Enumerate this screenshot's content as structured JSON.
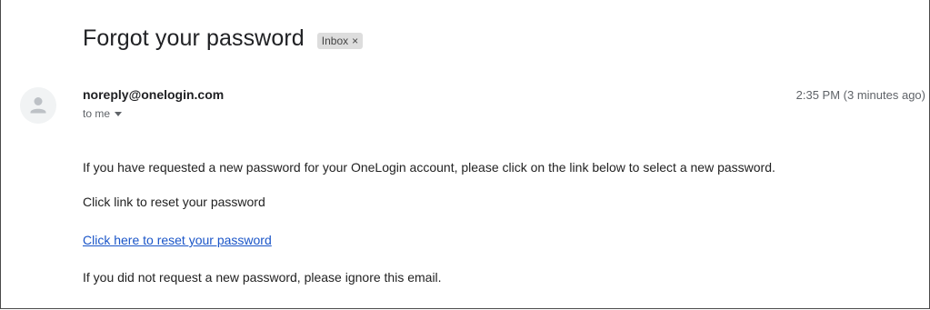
{
  "email": {
    "subject": "Forgot your password",
    "label": "Inbox",
    "label_close": "×",
    "sender": "noreply@onelogin.com",
    "recipient": "to me",
    "timestamp": "2:35 PM (3 minutes ago)",
    "body": {
      "line1": "If you have requested a new password for your OneLogin account, please click on the link below to select a new password.",
      "line2": "Click link to reset your password",
      "link_text": "Click here to reset your password",
      "line4": "If you did not request a new password, please ignore this email."
    }
  },
  "icons": {
    "avatar": "default-person-avatar-icon",
    "recipient_details": "chevron-down-icon"
  },
  "colors": {
    "link": "#1a55c8",
    "label_chip_bg": "#dddddd",
    "muted_text": "#5f6368"
  }
}
